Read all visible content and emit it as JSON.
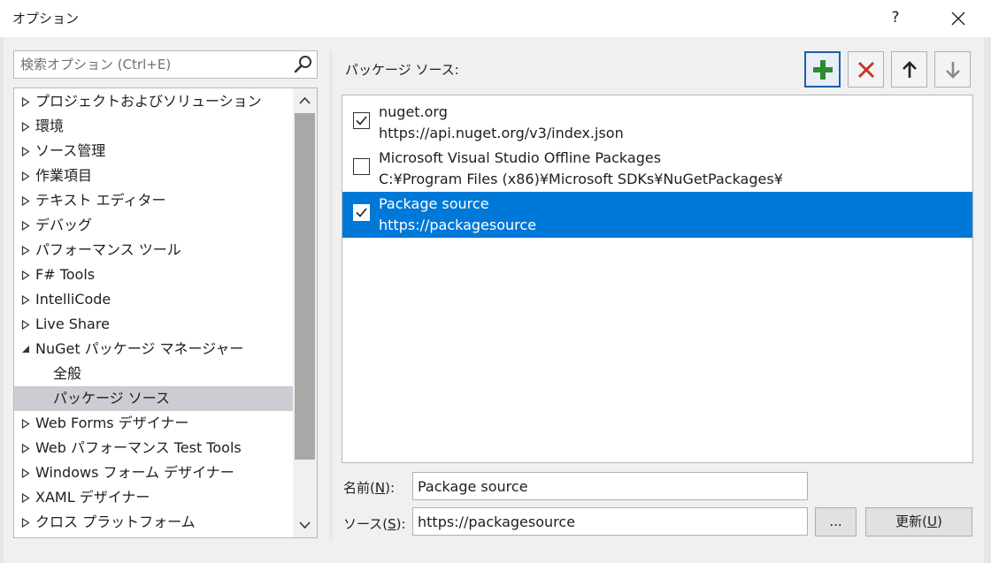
{
  "window": {
    "title": "オプション",
    "help_label": "?"
  },
  "search": {
    "placeholder": "検索オプション (Ctrl+E)"
  },
  "tree": {
    "items": [
      {
        "label": "プロジェクトおよびソリューション",
        "expanded": false
      },
      {
        "label": "環境",
        "expanded": false
      },
      {
        "label": "ソース管理",
        "expanded": false
      },
      {
        "label": "作業項目",
        "expanded": false
      },
      {
        "label": "テキスト エディター",
        "expanded": false
      },
      {
        "label": "デバッグ",
        "expanded": false
      },
      {
        "label": "パフォーマンス ツール",
        "expanded": false
      },
      {
        "label": "F# Tools",
        "expanded": false
      },
      {
        "label": "IntelliCode",
        "expanded": false
      },
      {
        "label": "Live Share",
        "expanded": false
      },
      {
        "label": "NuGet パッケージ マネージャー",
        "expanded": true
      },
      {
        "label": "全般",
        "child": true
      },
      {
        "label": "パッケージ ソース",
        "child": true,
        "selected": true
      },
      {
        "label": "Web Forms デザイナー",
        "expanded": false
      },
      {
        "label": "Web パフォーマンス Test Tools",
        "expanded": false
      },
      {
        "label": "Windows フォーム デザイナー",
        "expanded": false
      },
      {
        "label": "XAML デザイナー",
        "expanded": false
      },
      {
        "label": "クロス プラットフォーム",
        "expanded": false
      }
    ]
  },
  "package_sources": {
    "label": "パッケージ ソース:",
    "sources": [
      {
        "name": "nuget.org",
        "url": "https://api.nuget.org/v3/index.json",
        "checked": true,
        "selected": false
      },
      {
        "name": "Microsoft Visual Studio Offline Packages",
        "url": "C:¥Program Files (x86)¥Microsoft SDKs¥NuGetPackages¥",
        "checked": false,
        "selected": false
      },
      {
        "name": "Package source",
        "url": "https://packagesource",
        "checked": true,
        "selected": true
      }
    ]
  },
  "form": {
    "name_label": "名前(",
    "name_key": "N",
    "name_label_end": "):",
    "name_value": "Package source",
    "source_label": "ソース(",
    "source_key": "S",
    "source_label_end": "):",
    "source_value": "https://packagesource",
    "browse_label": "...",
    "update_label": "更新(",
    "update_key": "U",
    "update_label_end": ")"
  },
  "colors": {
    "selection": "#0078d7",
    "tree_selection": "#ccccd4",
    "add_icon": "#2e8b2e",
    "remove_icon": "#c0392b"
  }
}
